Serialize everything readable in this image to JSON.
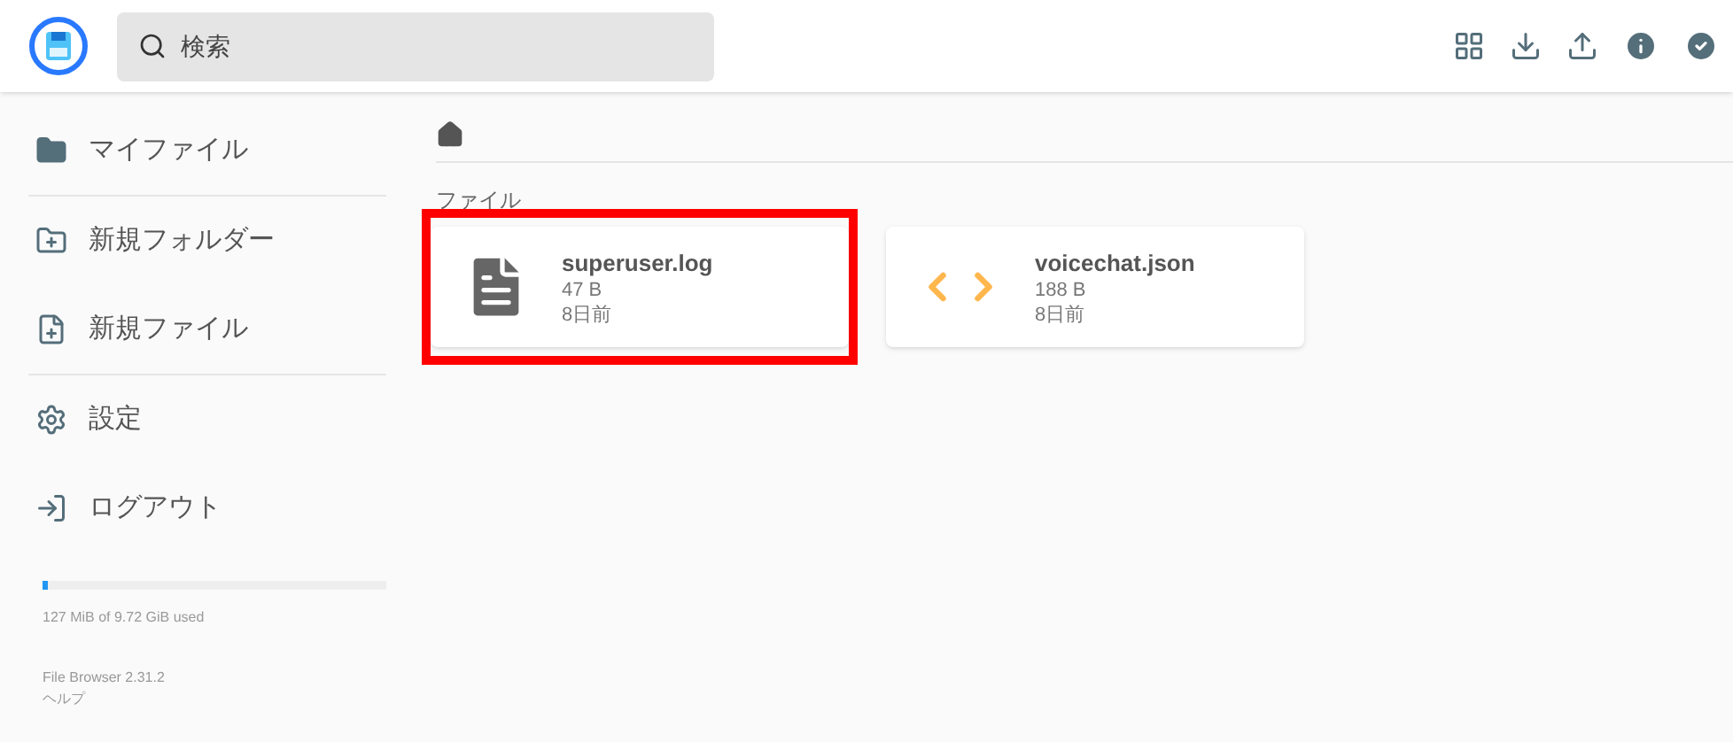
{
  "header": {
    "search": {
      "placeholder": "検索"
    }
  },
  "sidebar": {
    "items": [
      {
        "label": "マイファイル",
        "kind": "folder"
      },
      {
        "label": "新規フォルダー",
        "kind": "new-folder"
      },
      {
        "label": "新規ファイル",
        "kind": "new-file"
      },
      {
        "label": "設定",
        "kind": "settings"
      },
      {
        "label": "ログアウト",
        "kind": "logout"
      }
    ],
    "storage": {
      "level": 0.013,
      "text": "127 MiB of 9.72 GiB used"
    },
    "version": "File Browser 2.31.2",
    "help": "ヘルプ"
  },
  "section_title": "ファイル",
  "files": [
    {
      "name": "superuser.log",
      "size": "47 B",
      "age": "8日前",
      "kind": "document",
      "highlighted": true
    },
    {
      "name": "voicechat.json",
      "size": "188 B",
      "age": "8日前",
      "kind": "code",
      "highlighted": false
    }
  ]
}
